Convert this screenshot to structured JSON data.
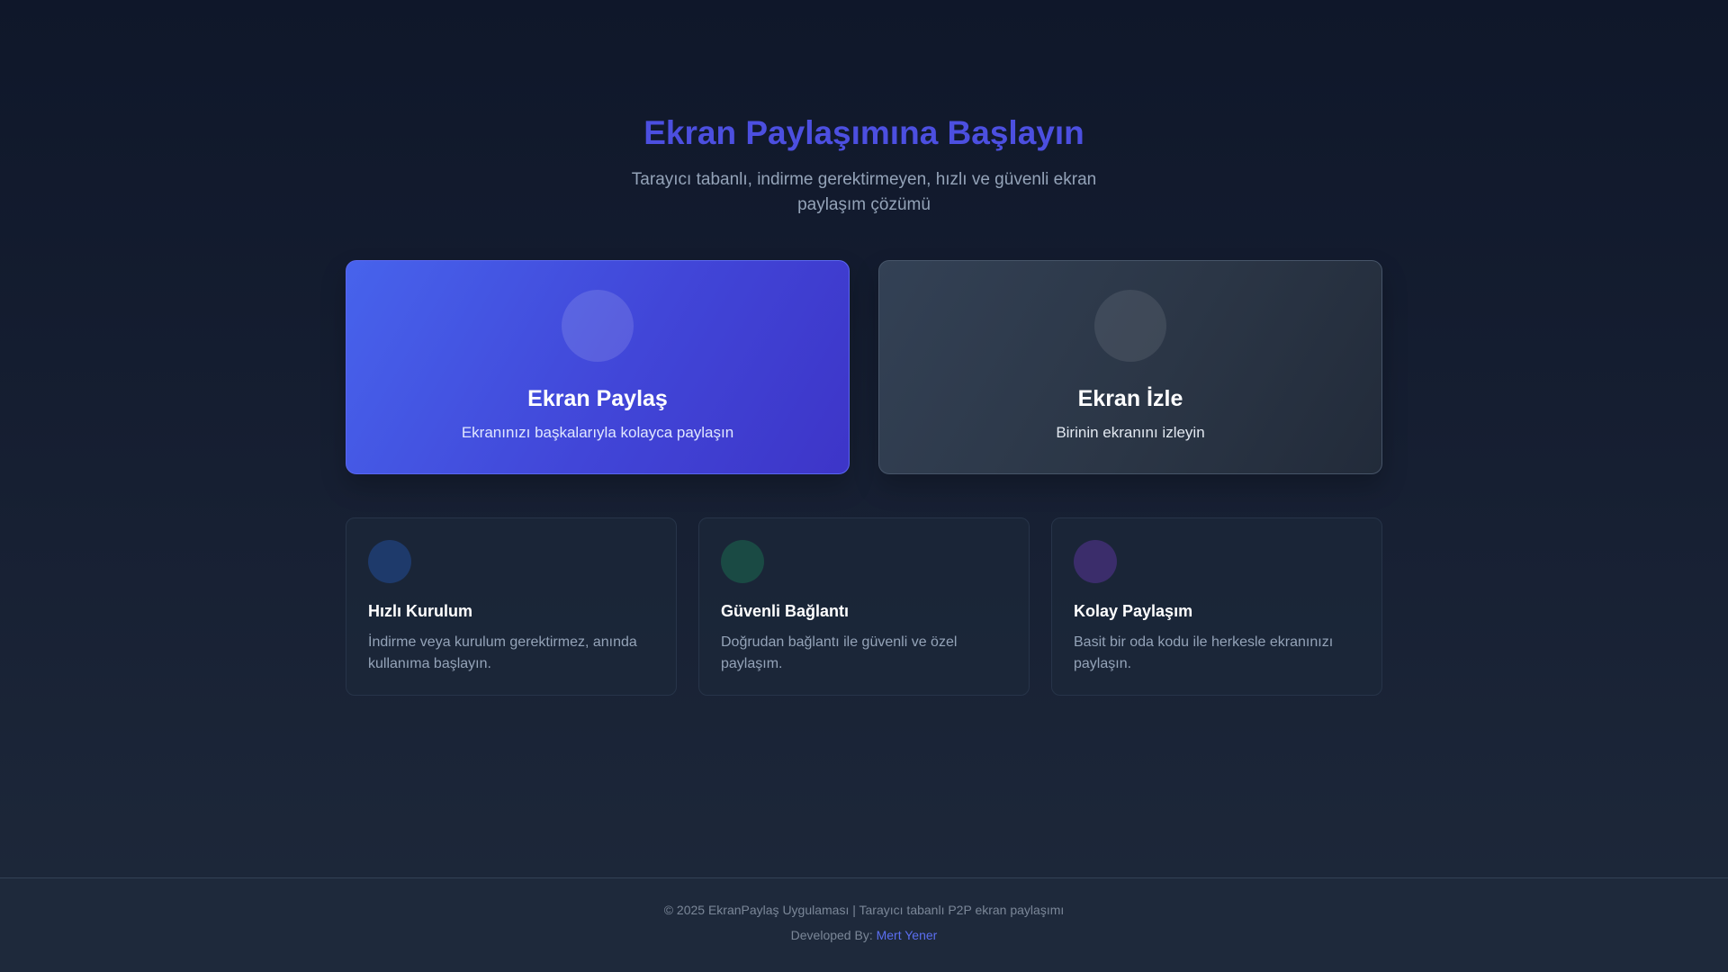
{
  "hero": {
    "title": "Ekran Paylaşımına Başlayın",
    "subtitle": "Tarayıcı tabanlı, indirme gerektirmeyen, hızlı ve güvenli ekran paylaşım çözümü"
  },
  "actions": [
    {
      "title": "Ekran Paylaş",
      "description": "Ekranınızı başkalarıyla kolayca paylaşın",
      "icon": "screen-share-icon"
    },
    {
      "title": "Ekran İzle",
      "description": "Birinin ekranını izleyin",
      "icon": "eye-icon"
    }
  ],
  "features": [
    {
      "title": "Hızlı Kurulum",
      "description": "İndirme veya kurulum gerektirmez, anında kullanıma başlayın.",
      "icon": "lightning-icon",
      "color": "#1e3a6b"
    },
    {
      "title": "Güvenli Bağlantı",
      "description": "Doğrudan bağlantı ile güvenli ve özel paylaşım.",
      "icon": "lock-icon",
      "color": "#1a4a44"
    },
    {
      "title": "Kolay Paylaşım",
      "description": "Basit bir oda kodu ile herkesle ekranınızı paylaşın.",
      "icon": "share-icon",
      "color": "#3b2d6b"
    }
  ],
  "footer": {
    "copyright": "© 2025 EkranPaylaş Uygulaması | Tarayıcı tabanlı P2P ekran paylaşımı",
    "developed_by_label": "Developed By:",
    "developer_name": "Mert Yener"
  }
}
